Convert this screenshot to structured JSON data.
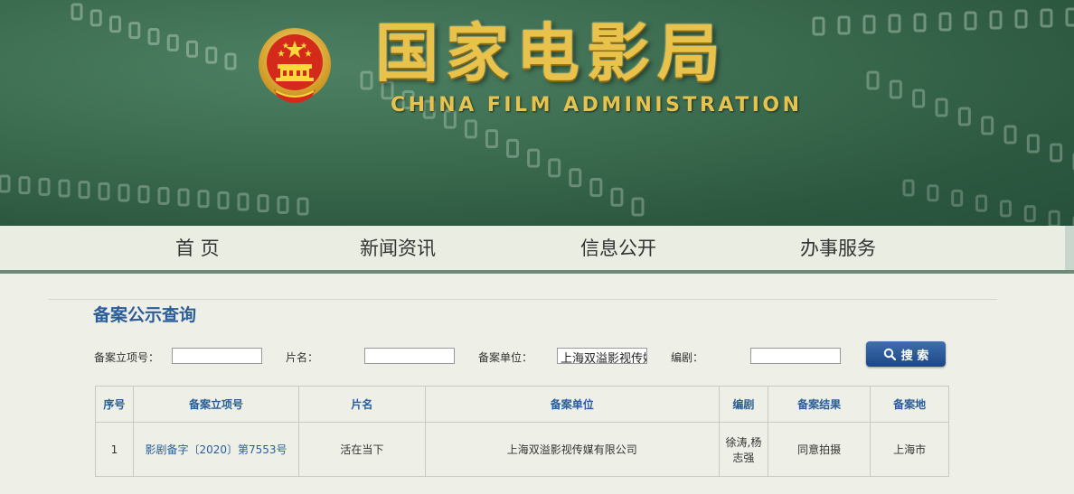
{
  "header": {
    "title_cn": [
      "国",
      "家",
      "电",
      "影",
      "局"
    ],
    "title_en": "CHINA FILM ADMINISTRATION"
  },
  "nav": {
    "items": [
      "首 页",
      "新闻资讯",
      "信息公开",
      "办事服务"
    ]
  },
  "search": {
    "section_title": "备案公示查询",
    "fields": {
      "record_no_label": "备案立项号：",
      "record_no_value": "",
      "title_label": "片名：",
      "title_value": "",
      "unit_label": "备案单位：",
      "unit_value": "上海双溢影视传娱",
      "writer_label": "编剧：",
      "writer_value": ""
    },
    "button_label": "搜 索"
  },
  "table": {
    "headers": [
      "序号",
      "备案立项号",
      "片名",
      "备案单位",
      "编剧",
      "备案结果",
      "备案地"
    ],
    "rows": [
      [
        "1",
        "影剧备字〔2020〕第7553号",
        "活在当下",
        "上海双溢影视传媒有限公司",
        "徐涛,杨志强",
        "同意拍摄",
        "上海市"
      ]
    ]
  }
}
